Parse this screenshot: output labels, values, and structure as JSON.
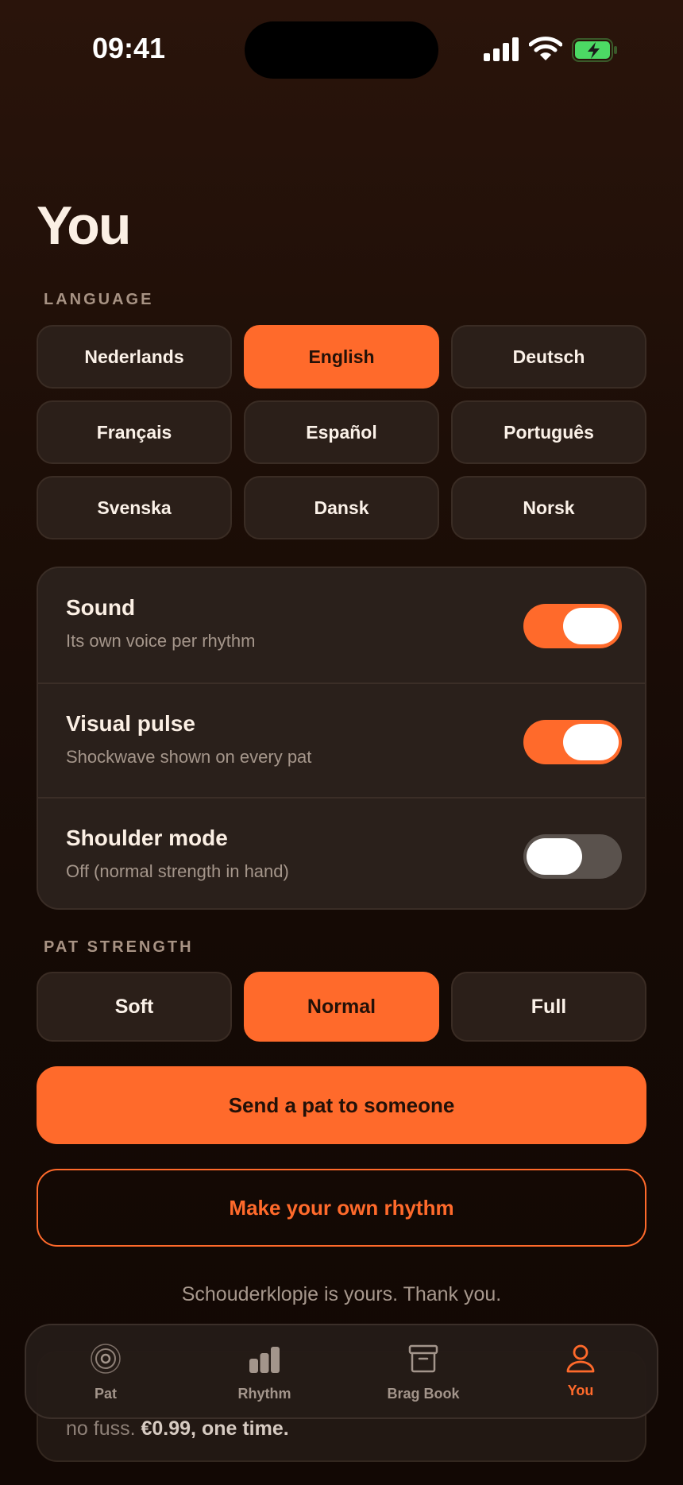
{
  "status": {
    "time": "09:41"
  },
  "page": {
    "title": "You"
  },
  "language": {
    "label": "LANGUAGE",
    "options": [
      "Nederlands",
      "English",
      "Deutsch",
      "Français",
      "Español",
      "Português",
      "Svenska",
      "Dansk",
      "Norsk"
    ],
    "selected": "English"
  },
  "settings": [
    {
      "title": "Sound",
      "subtitle": "Its own voice per rhythm",
      "on": true
    },
    {
      "title": "Visual pulse",
      "subtitle": "Shockwave shown on every pat",
      "on": true
    },
    {
      "title": "Shoulder mode",
      "subtitle": "Off (normal strength in hand)",
      "on": false
    }
  ],
  "strength": {
    "label": "PAT STRENGTH",
    "options": [
      "Soft",
      "Normal",
      "Full"
    ],
    "selected": "Normal"
  },
  "actions": {
    "send": "Send a pat to someone",
    "make": "Make your own rhythm"
  },
  "thanks": "Schouderklopje is yours. Thank you.",
  "purchase": {
    "text": "no fuss. ",
    "price": "€0.99, one time."
  },
  "tabs": [
    {
      "label": "Pat",
      "icon": "pulse-icon"
    },
    {
      "label": "Rhythm",
      "icon": "bars-icon"
    },
    {
      "label": "Brag Book",
      "icon": "archive-icon"
    },
    {
      "label": "You",
      "icon": "person-icon"
    }
  ],
  "active_tab": "You",
  "colors": {
    "accent": "#ff6a2b",
    "background": "#1d0e07",
    "card": "#2a201b",
    "muted_text": "#a5968b"
  }
}
